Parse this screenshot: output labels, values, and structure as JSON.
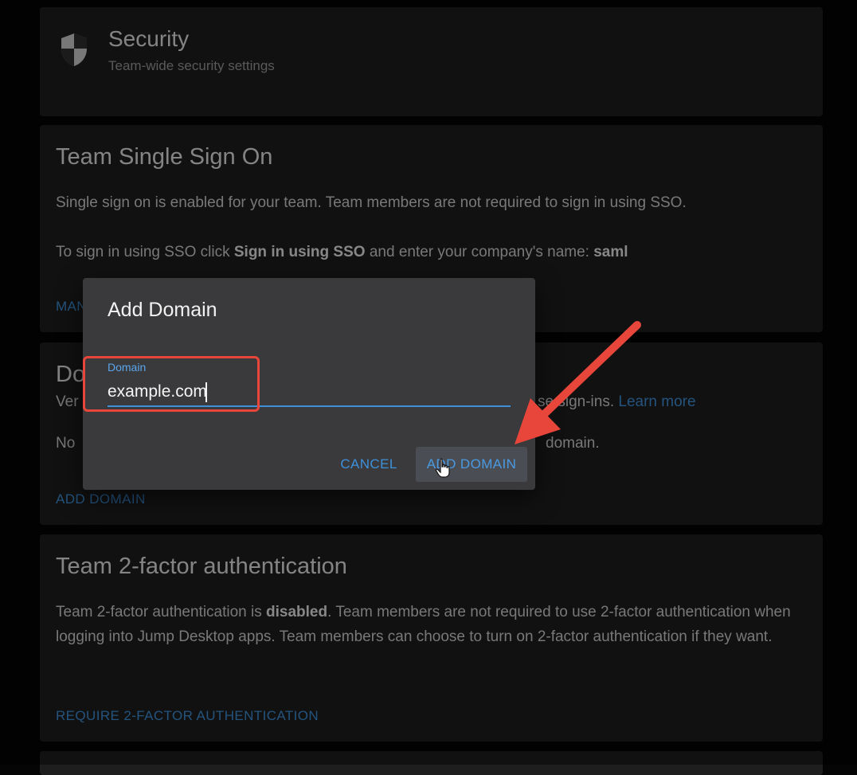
{
  "security": {
    "title": "Security",
    "subtitle": "Team-wide security settings",
    "icon": "shield-icon"
  },
  "sso": {
    "title": "Team Single Sign On",
    "description": "Single sign on is enabled for your team. Team members are not required to sign in using SSO.",
    "instruction_prefix": "To sign in using SSO click ",
    "instruction_bold": "Sign in using SSO",
    "instruction_middle": " and enter your company's name: ",
    "company_name": "saml",
    "manage_button_partial": "MAN"
  },
  "domains": {
    "title_partial": "Do",
    "description_start": "Ver",
    "description_end": "se sign-ins.",
    "learn_more": "Learn more",
    "empty_start": "No",
    "empty_end": "domain.",
    "add_domain_button": "ADD DOMAIN"
  },
  "two_factor": {
    "title": "Team 2-factor authentication",
    "text_prefix": "Team 2-factor authentication is ",
    "status": "disabled",
    "text_suffix": ". Team members are not required to use 2-factor authentication when logging into Jump Desktop apps. Team members can choose to turn on 2-factor authentication if they want.",
    "require_button": "REQUIRE 2-FACTOR AUTHENTICATION"
  },
  "dialog": {
    "title": "Add Domain",
    "field_label": "Domain",
    "field_value": "example.com",
    "cancel_label": "CANCEL",
    "add_label": "ADD DOMAIN"
  },
  "colors": {
    "accent": "#3e90d9",
    "annotation": "#e8463a",
    "card": "#1e1e1e",
    "dialog": "#3a3a3c"
  }
}
